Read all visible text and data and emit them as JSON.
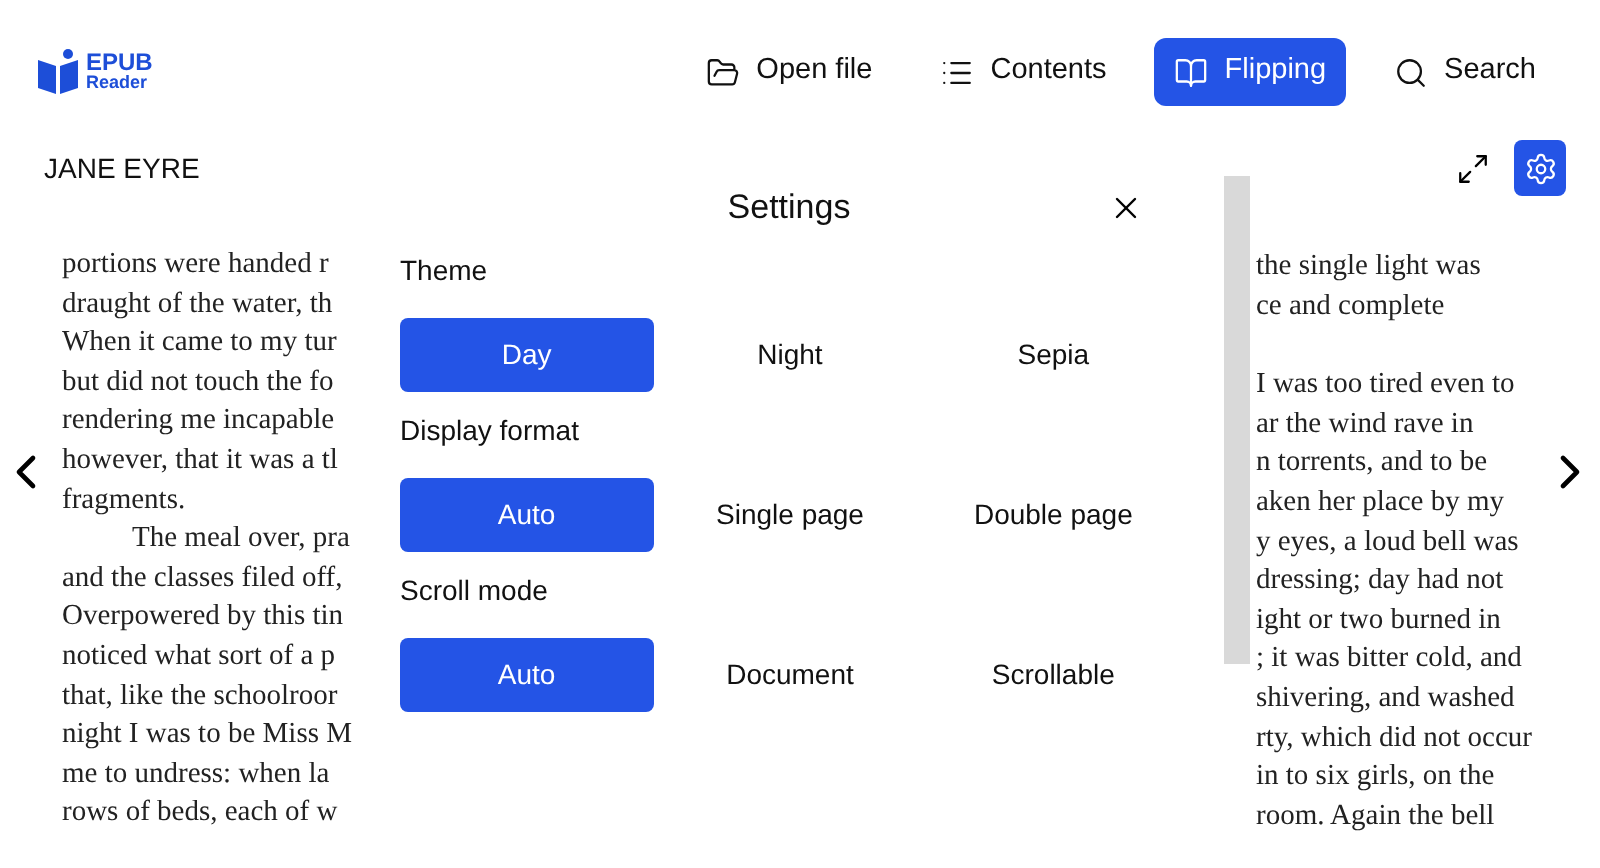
{
  "logo": {
    "line_1": "EPUB",
    "line_2": "Reader"
  },
  "nav": [
    {
      "label": "Open file",
      "selected": false
    },
    {
      "label": "Contents",
      "selected": false
    },
    {
      "label": "Flipping",
      "selected": true
    },
    {
      "label": "Search",
      "selected": false
    }
  ],
  "book_title": "JANE EYRE",
  "settings_open": true,
  "left_page": {
    "continued_lines": [
      "portions were handed r",
      "draught of the water, th",
      "When it came to my tur",
      "but did not touch the fo",
      "rendering me incapable",
      "however, that it was a tl",
      "fragments."
    ],
    "paragraphs": [
      {
        "lines": [
          "The meal over, pra",
          "and the classes filed off,",
          "Overpowered by this tin",
          "noticed what sort of a p",
          "that, like the schoolroor",
          "night I was to be Miss M",
          "me to undress: when la",
          "rows of beds, each of w"
        ]
      }
    ]
  },
  "right_page": {
    "blocks": [
      {
        "lines": [
          "the single light was",
          "ce and complete"
        ]
      },
      {
        "lines": [
          "I was too tired even to",
          "ar the wind rave in",
          "n torrents, and to be",
          "aken her place by my",
          "y eyes, a loud bell was",
          "dressing; day had not",
          "ight or two burned in",
          "; it was bitter cold, and",
          "shivering, and washed",
          "rty, which did not occur",
          "in to six girls, on the",
          "room. Again the bell"
        ]
      }
    ]
  },
  "settings": {
    "title": "Settings",
    "groups": [
      {
        "label": "Theme",
        "options": [
          {
            "label": "Day",
            "selected": true
          },
          {
            "label": "Night",
            "selected": false
          },
          {
            "label": "Sepia",
            "selected": false
          }
        ]
      },
      {
        "label": "Display format",
        "options": [
          {
            "label": "Auto",
            "selected": true
          },
          {
            "label": "Single page",
            "selected": false
          },
          {
            "label": "Double page",
            "selected": false
          }
        ]
      },
      {
        "label": "Scroll mode",
        "options": [
          {
            "label": "Auto",
            "selected": true
          },
          {
            "label": "Document",
            "selected": false
          },
          {
            "label": "Scrollable",
            "selected": false
          }
        ]
      }
    ]
  }
}
